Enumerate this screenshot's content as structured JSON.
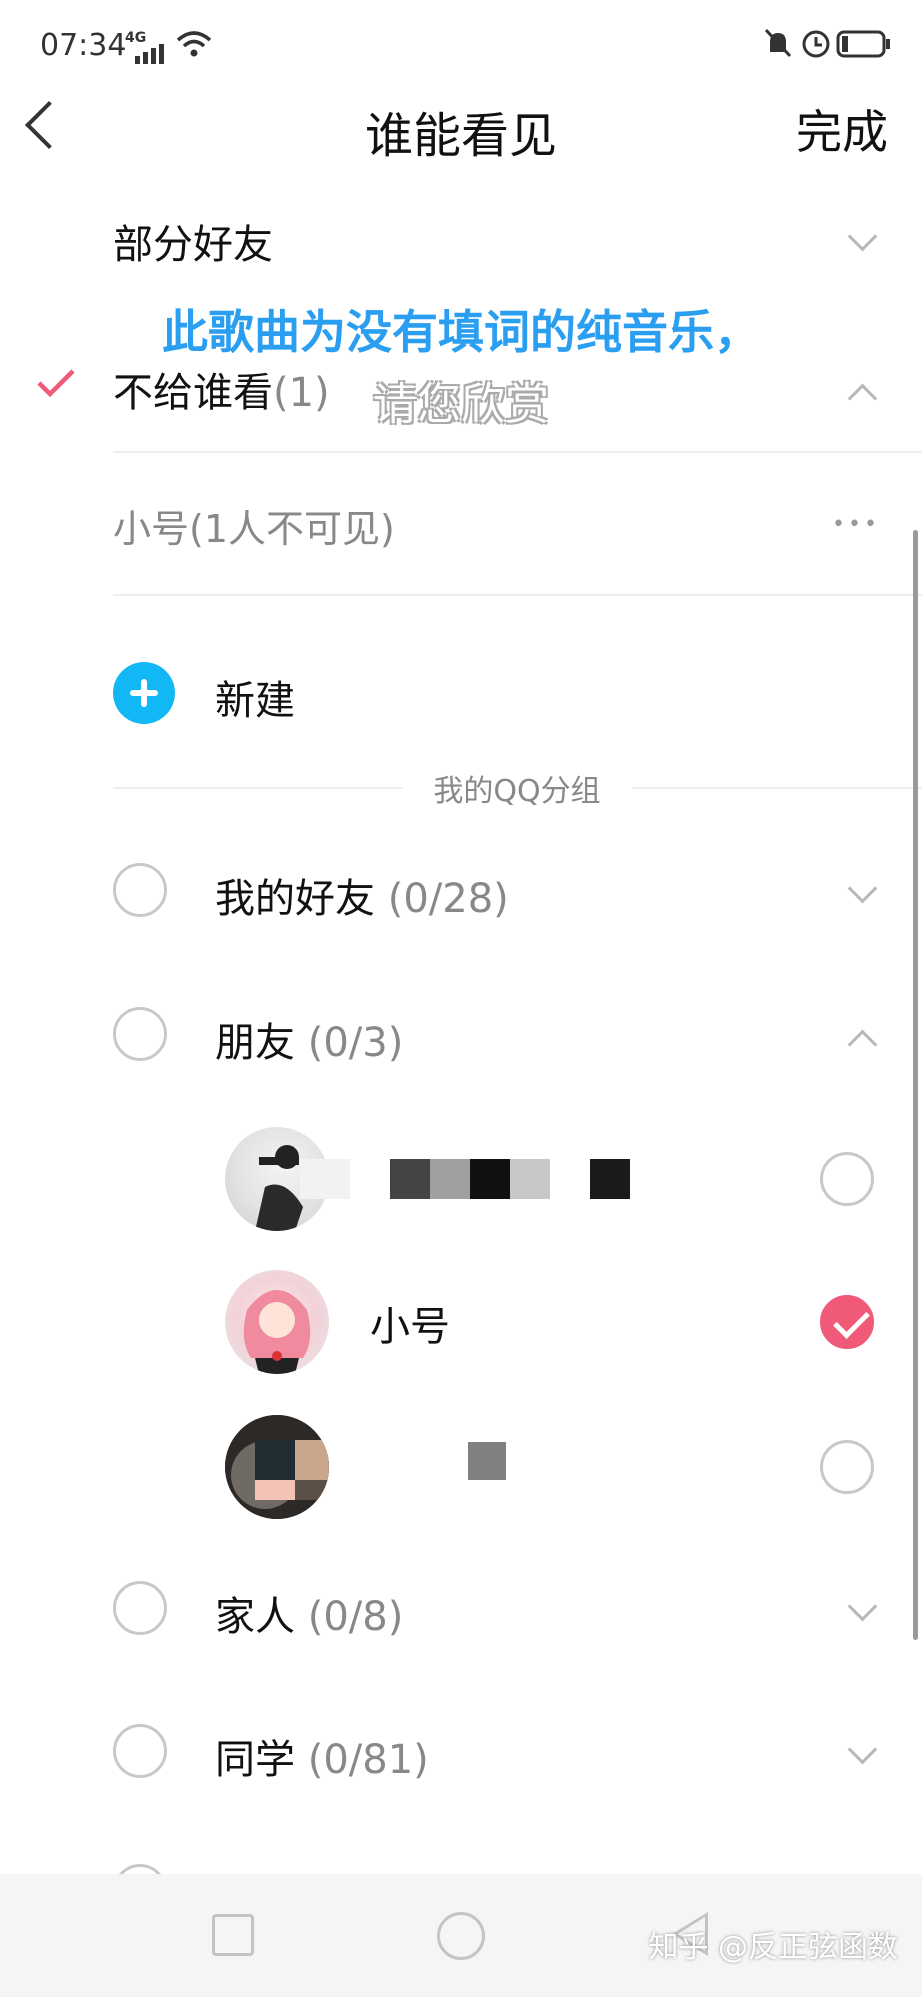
{
  "status_bar": {
    "time": "07:34",
    "network": "4G"
  },
  "header": {
    "title": "谁能看见",
    "done_label": "完成"
  },
  "options": [
    {
      "label": "部分好友",
      "count": ""
    },
    {
      "label": "不给谁看",
      "count": "(1)",
      "selected": true
    }
  ],
  "hidden_group": {
    "label": "小号(1人不可见)",
    "more_label": "•••"
  },
  "new_label": "新建",
  "section_label": "我的QQ分组",
  "groups": [
    {
      "name": "我的好友",
      "count": "(0/28)",
      "expanded": false
    },
    {
      "name": "朋友",
      "count": "(0/3)",
      "expanded": true
    },
    {
      "name": "家人",
      "count": "(0/8)",
      "expanded": false
    },
    {
      "name": "同学",
      "count": "(0/81)",
      "expanded": false
    }
  ],
  "friends": [
    {
      "name": "",
      "checked": false
    },
    {
      "name": "小号",
      "checked": true
    },
    {
      "name": "",
      "checked": false
    }
  ],
  "overlay": {
    "line1": "此歌曲为没有填词的纯音乐，",
    "line2": "请您欣赏"
  },
  "watermark": "知乎 @反正弦函数",
  "colors": {
    "accent": "#f05a78",
    "primary_blue": "#12b7f5",
    "caption_blue": "#2a9ef0"
  }
}
